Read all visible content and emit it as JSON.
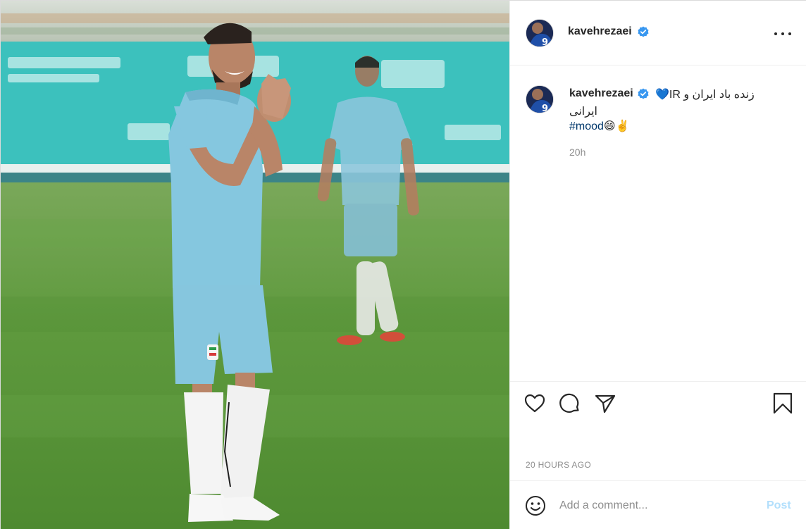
{
  "post": {
    "username": "kavehrezaei",
    "verified": true,
    "caption": {
      "line1_text": "زنده باد ایران و IR",
      "line1_emoji": "💙",
      "line2": "ایرانی",
      "hashtag": "#mood",
      "hashtag_emojis": "😄✌️"
    },
    "time_short": "20h",
    "time_long": "20 HOURS AGO"
  },
  "icons": {
    "more": "more-options-icon",
    "like": "heart-icon",
    "comment": "comment-bubble-icon",
    "share": "paper-plane-icon",
    "save": "bookmark-icon",
    "emoji": "emoji-smile-icon",
    "verified": "verified-badge-icon"
  },
  "comment_box": {
    "placeholder": "Add a comment...",
    "post_label": "Post"
  },
  "colors": {
    "accent_blue": "#0095f6",
    "verified_blue": "#3897f0",
    "post_button_disabled": "#b2dffc",
    "hashtag": "#00376b",
    "jersey": "#7ec3dd"
  }
}
